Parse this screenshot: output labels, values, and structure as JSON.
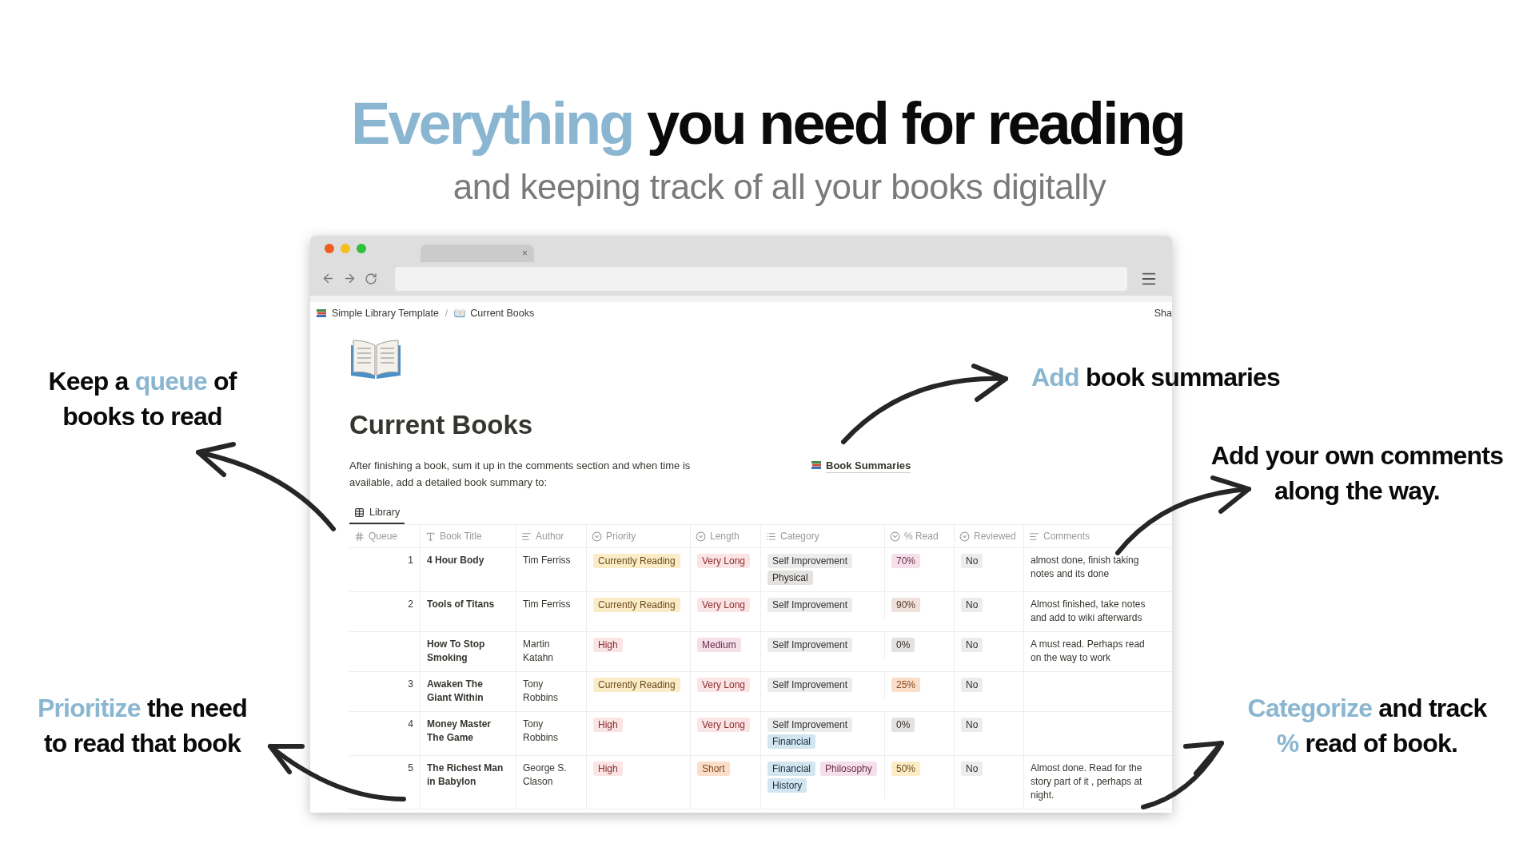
{
  "headline": [
    {
      "text": "Everything",
      "accent": true
    },
    {
      "text": "you need for reading",
      "accent": false
    }
  ],
  "subtitle": "and keeping track of all your books digitally",
  "annotations": [
    {
      "lines": [
        [
          {
            "text": "Keep a ",
            "accent": false
          },
          {
            "text": "queue",
            "accent": true
          },
          {
            "text": " of",
            "accent": false
          }
        ],
        [
          {
            "text": "books to read",
            "accent": false
          }
        ]
      ]
    },
    {
      "lines": [
        [
          {
            "text": "Add",
            "accent": true
          },
          {
            "text": " book summaries",
            "accent": false
          }
        ]
      ]
    },
    {
      "lines": [
        [
          {
            "text": "Add your own comments",
            "accent": false
          }
        ],
        [
          {
            "text": "along the way.",
            "accent": false
          }
        ]
      ]
    },
    {
      "lines": [
        [
          {
            "text": "Prioritize",
            "accent": true
          },
          {
            "text": " the need",
            "accent": false
          }
        ],
        [
          {
            "text": "to read that book",
            "accent": false
          }
        ]
      ]
    },
    {
      "lines": [
        [
          {
            "text": "Categorize",
            "accent": true
          },
          {
            "text": " and track",
            "accent": false
          }
        ],
        [
          {
            "text": "%",
            "accent": true
          },
          {
            "text": " read of book.",
            "accent": false
          }
        ]
      ]
    }
  ],
  "browser": {
    "tab_close": "×"
  },
  "breadcrumb": [
    {
      "label": "Simple Library Template"
    },
    {
      "label": "Current Books"
    }
  ],
  "breadcrumb_separator": "/",
  "share_button": "Sha",
  "page": {
    "title": "Current Books",
    "description": "After finishing a book, sum it up in the comments section and when time is available, add a detailed book summary to:",
    "link": "Book Summaries"
  },
  "view_tab": {
    "label": "Library",
    "selected": true
  },
  "table": {
    "columns": [
      {
        "label": "Queue",
        "kind": "number"
      },
      {
        "label": "Book Title",
        "kind": "title"
      },
      {
        "label": "Author",
        "kind": "text"
      },
      {
        "label": "Priority",
        "kind": "select"
      },
      {
        "label": "Length",
        "kind": "select"
      },
      {
        "label": "Category",
        "kind": "multi"
      },
      {
        "label": "% Read",
        "kind": "select"
      },
      {
        "label": "Reviewed",
        "kind": "select"
      },
      {
        "label": "Comments",
        "kind": "text"
      }
    ],
    "rows": [
      {
        "queue": "1",
        "title": "4 Hour Body",
        "author": "Tim Ferriss",
        "priority": {
          "label": "Currently Reading",
          "color": "#fbecc8"
        },
        "length": {
          "label": "Very Long",
          "color": "#fbe4e4"
        },
        "category": [
          {
            "label": "Self Improvement",
            "color": "#ebeced"
          },
          {
            "label": "Physical",
            "color": "#e3e2e0"
          }
        ],
        "read": {
          "label": "70%",
          "color": "#f5e0e9"
        },
        "reviewed": {
          "label": "No",
          "color": "#ebeced"
        },
        "comments": "almost done, finish taking notes and its done"
      },
      {
        "queue": "2",
        "title": "Tools of Titans",
        "author": "Tim Ferriss",
        "priority": {
          "label": "Currently Reading",
          "color": "#fbecc8"
        },
        "length": {
          "label": "Very Long",
          "color": "#fbe4e4"
        },
        "category": [
          {
            "label": "Self Improvement",
            "color": "#ebeced"
          }
        ],
        "read": {
          "label": "90%",
          "color": "#eee0da"
        },
        "reviewed": {
          "label": "No",
          "color": "#ebeced"
        },
        "comments": "Almost finished, take notes and add to wiki afterwards"
      },
      {
        "title": "How To Stop Smoking",
        "author": "Martin Katahn",
        "priority": {
          "label": "High",
          "color": "#fbe4e4"
        },
        "length": {
          "label": "Medium",
          "color": "#f5e0e9"
        },
        "category": [
          {
            "label": "Self Improvement",
            "color": "#ebeced"
          }
        ],
        "read": {
          "label": "0%",
          "color": "#e3e2e0"
        },
        "reviewed": {
          "label": "No",
          "color": "#ebeced"
        },
        "comments": "A must read. Perhaps read on the way to work"
      },
      {
        "queue": "3",
        "title": "Awaken The Giant Within",
        "author": "Tony Robbins",
        "priority": {
          "label": "Currently Reading",
          "color": "#fbecc8"
        },
        "length": {
          "label": "Very Long",
          "color": "#fbe4e4"
        },
        "category": [
          {
            "label": "Self Improvement",
            "color": "#ebeced"
          }
        ],
        "read": {
          "label": "25%",
          "color": "#fadec9"
        },
        "reviewed": {
          "label": "No",
          "color": "#ebeced"
        }
      },
      {
        "queue": "4",
        "title": "Money Master The Game",
        "author": "Tony Robbins",
        "priority": {
          "label": "High",
          "color": "#fbe4e4"
        },
        "length": {
          "label": "Very Long",
          "color": "#fbe4e4"
        },
        "category": [
          {
            "label": "Self Improvement",
            "color": "#ebeced"
          },
          {
            "label": "Financial",
            "color": "#d3e5ef"
          }
        ],
        "read": {
          "label": "0%",
          "color": "#e3e2e0"
        },
        "reviewed": {
          "label": "No",
          "color": "#ebeced"
        }
      },
      {
        "queue": "5",
        "title": "The Richest Man in Babylon",
        "author": "George S. Clason",
        "priority": {
          "label": "High",
          "color": "#fbe4e4"
        },
        "length": {
          "label": "Short",
          "color": "#fadec9"
        },
        "category": [
          {
            "label": "Financial",
            "color": "#d3e5ef"
          },
          {
            "label": "Philosophy",
            "color": "#f5e0e9"
          },
          {
            "label": "History",
            "color": "#d3e5ef"
          }
        ],
        "read": {
          "label": "50%",
          "color": "#fdecc8"
        },
        "reviewed": {
          "label": "No",
          "color": "#ebeced"
        },
        "comments": "Almost done. Read for the story part of it , perhaps at night."
      }
    ]
  }
}
